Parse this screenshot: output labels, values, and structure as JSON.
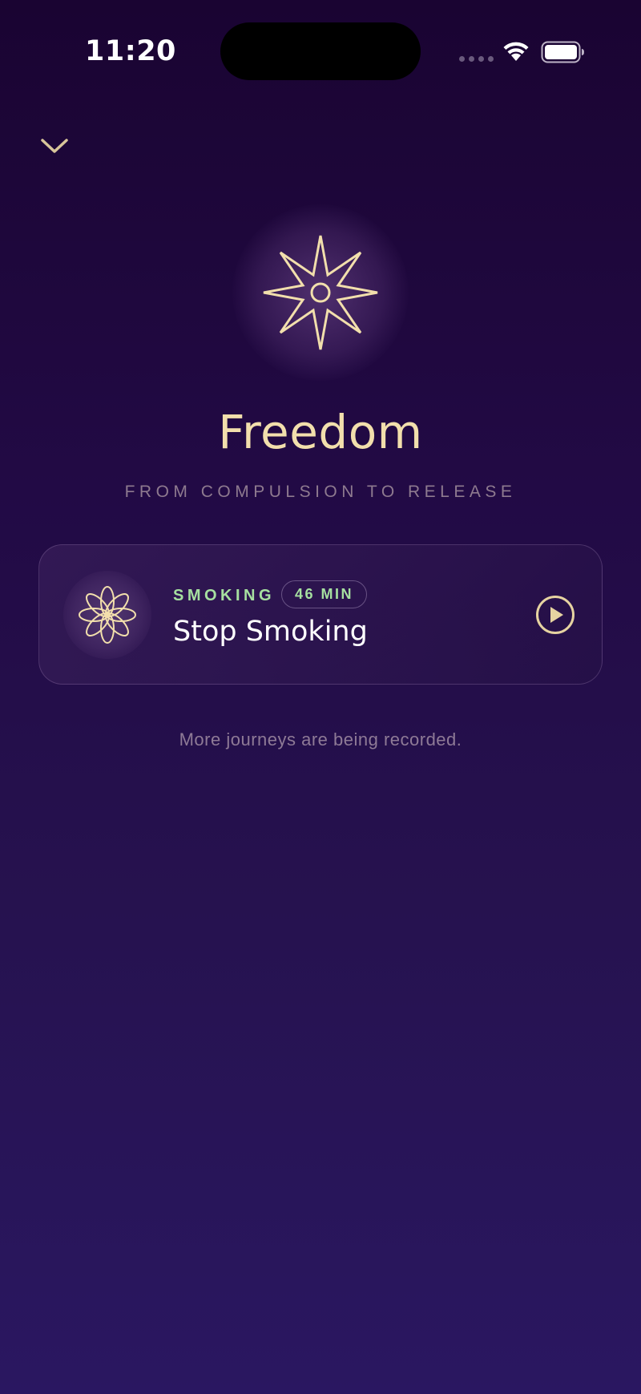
{
  "status_bar": {
    "time": "11:20",
    "wifi_icon": "wifi-icon",
    "battery_icon": "battery-icon"
  },
  "nav": {
    "collapse_icon": "chevron-down-icon"
  },
  "hero": {
    "icon": "eight-point-star-icon",
    "title": "Freedom",
    "subtitle": "FROM COMPULSION TO RELEASE"
  },
  "journeys": [
    {
      "icon": "flower-icon",
      "category": "SMOKING",
      "duration": "46 MIN",
      "title": "Stop Smoking",
      "action_icon": "play-icon"
    }
  ],
  "footnote": "More journeys are being recorded.",
  "colors": {
    "accent_gold": "#f2dfac",
    "category_green": "#a6e0a0",
    "background_top": "#1a0432",
    "background_bottom": "#2a1761"
  }
}
